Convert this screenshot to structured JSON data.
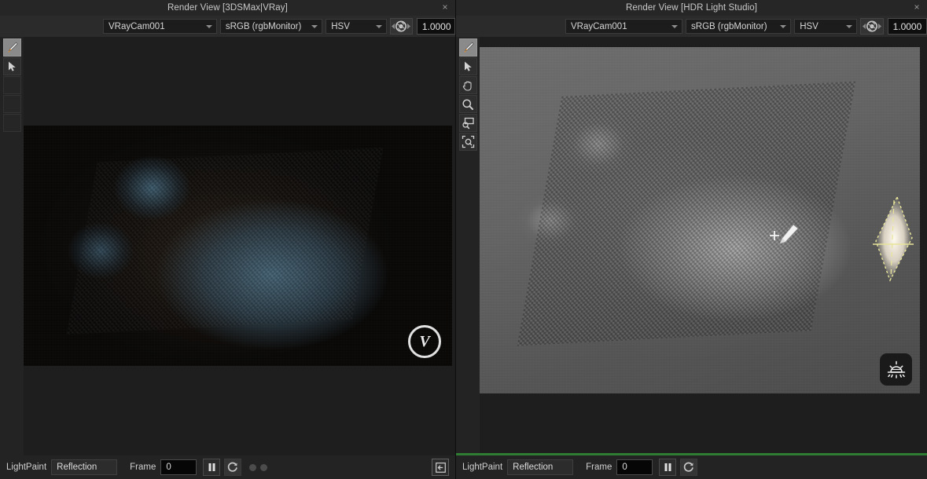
{
  "left_panel": {
    "title": "Render View [3DSMax|VRay]",
    "close_label": "×",
    "toolbar": {
      "camera": "VRayCam001",
      "color_space": "sRGB (rgbMonitor)",
      "channel": "HSV",
      "exposure": "1.0000",
      "aperture_icon": "aperture-icon"
    },
    "tools": [
      {
        "name": "lightpaint-brush-tool",
        "icon": "brush-icon",
        "active": true
      },
      {
        "name": "select-arrow-tool",
        "icon": "arrow-cursor-icon",
        "active": false
      },
      {
        "name": "empty-tool-slot-1",
        "icon": "blank-icon",
        "active": false
      },
      {
        "name": "empty-tool-slot-2",
        "icon": "blank-icon",
        "active": false
      },
      {
        "name": "empty-tool-slot-3",
        "icon": "blank-icon",
        "active": false
      }
    ],
    "render": {
      "watermark": "V",
      "watermark_name": "vray-logo"
    },
    "status": {
      "lightpaint_label": "LightPaint",
      "mode": "Reflection",
      "frame_label": "Frame",
      "frame_value": "0",
      "pause_icon": "pause-icon",
      "refresh_icon": "refresh-icon",
      "collapse_icon": "collapse-left-icon"
    },
    "active": false
  },
  "right_panel": {
    "title": "Render View [HDR Light Studio]",
    "close_label": "×",
    "toolbar": {
      "camera": "VRayCam001",
      "color_space": "sRGB (rgbMonitor)",
      "channel": "HSV",
      "exposure": "1.0000",
      "aperture_icon": "aperture-icon"
    },
    "tools": [
      {
        "name": "lightpaint-brush-tool",
        "icon": "brush-icon",
        "active": true
      },
      {
        "name": "select-arrow-tool",
        "icon": "arrow-cursor-icon",
        "active": false
      },
      {
        "name": "pan-hand-tool",
        "icon": "hand-icon",
        "active": false
      },
      {
        "name": "zoom-tool",
        "icon": "magnifier-icon",
        "active": false
      },
      {
        "name": "zoom-region-tool",
        "icon": "zoom-region-icon",
        "active": false
      },
      {
        "name": "zoom-fit-tool",
        "icon": "zoom-fit-icon",
        "active": false
      }
    ],
    "render": {
      "badge_name": "hdr-light-studio-sun-badge",
      "light_gizmo_name": "area-light-gizmo",
      "brush_cursor_name": "lightpaint-brush-cursor"
    },
    "status": {
      "lightpaint_label": "LightPaint",
      "mode": "Reflection",
      "frame_label": "Frame",
      "frame_value": "0",
      "pause_icon": "pause-icon",
      "refresh_icon": "refresh-icon"
    },
    "active": true,
    "active_color": "#2f7d32"
  },
  "theme": {
    "window_bg": "#1b1b1b",
    "panel_bg": "#232323",
    "titlebar_bg": "#262626",
    "toolbar_bg": "#2b2b2b",
    "text": "#cfcfcf",
    "accent_active": "#2f7d32"
  }
}
